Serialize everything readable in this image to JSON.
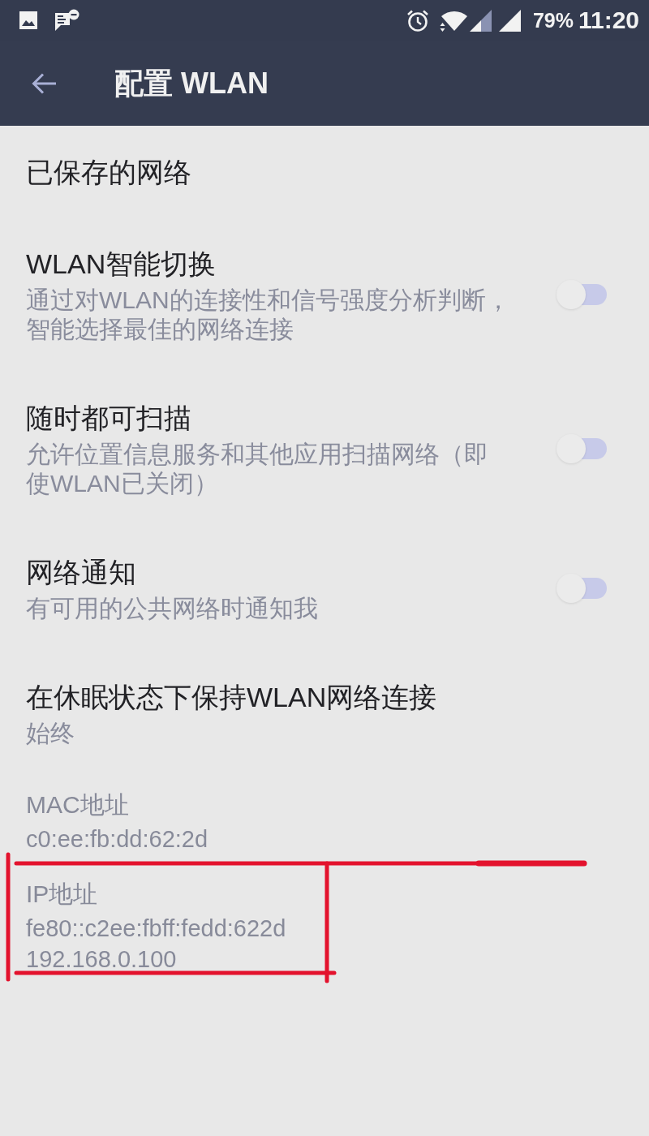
{
  "status_bar": {
    "battery": "79%",
    "time": "11:20"
  },
  "app_bar": {
    "title": "配置 WLAN"
  },
  "items": [
    {
      "kind": "header",
      "title": "已保存的网络"
    },
    {
      "kind": "toggle",
      "title": "WLAN智能切换",
      "summary": "通过对WLAN的连接性和信号强度分析判断，智能选择最佳的网络连接",
      "on": false
    },
    {
      "kind": "toggle",
      "title": "随时都可扫描",
      "summary": "允许位置信息服务和其他应用扫描网络（即使WLAN已关闭）",
      "on": false
    },
    {
      "kind": "toggle",
      "title": "网络通知",
      "summary": "有可用的公共网络时通知我",
      "on": false
    },
    {
      "kind": "option",
      "title": "在休眠状态下保持WLAN网络连接",
      "summary": "始终"
    },
    {
      "kind": "info",
      "title": "MAC地址",
      "values": [
        "c0:ee:fb:dd:62:2d"
      ],
      "marked": false
    },
    {
      "kind": "info",
      "title": "IP地址",
      "values": [
        "fe80::c2ee:fbff:fedd:622d",
        "192.168.0.100"
      ],
      "marked": true
    }
  ]
}
